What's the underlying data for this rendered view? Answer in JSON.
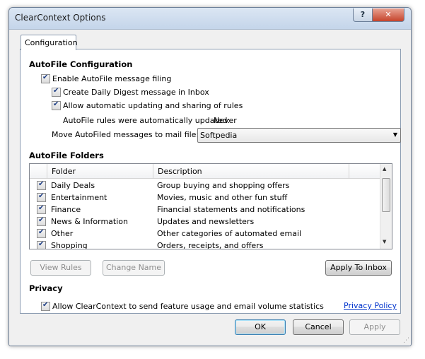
{
  "window": {
    "title": "ClearContext Options"
  },
  "titlebar": {
    "help": "?",
    "close": "✕"
  },
  "tab": {
    "label": "Configuration"
  },
  "autofile": {
    "heading": "AutoFile Configuration",
    "enable": "Enable AutoFile message filing",
    "digest": "Create Daily Digest message in Inbox",
    "auto_update": "Allow automatic updating and sharing of rules",
    "rules_status_label": "AutoFile rules were automatically updated:",
    "rules_status_value": "Never",
    "move_label": "Move AutoFiled messages to mail file:",
    "move_value": "Softpedia"
  },
  "folders": {
    "heading": "AutoFile Folders",
    "col_folder": "Folder",
    "col_description": "Description",
    "rows": [
      {
        "folder": "Daily Deals",
        "description": "Group buying and shopping offers"
      },
      {
        "folder": "Entertainment",
        "description": "Movies, music and other fun stuff"
      },
      {
        "folder": "Finance",
        "description": "Financial statements and notifications"
      },
      {
        "folder": "News & Information",
        "description": "Updates and newsletters"
      },
      {
        "folder": "Other",
        "description": "Other categories of automated email"
      },
      {
        "folder": "Shopping",
        "description": "Orders, receipts, and offers"
      }
    ],
    "view_rules": "View Rules",
    "change_name": "Change Name",
    "apply_inbox": "Apply To Inbox"
  },
  "privacy": {
    "heading": "Privacy",
    "allow_stats": "Allow ClearContext to send feature usage and email volume statistics",
    "policy_link": "Privacy Policy"
  },
  "footer": {
    "ok": "OK",
    "cancel": "Cancel",
    "apply": "Apply"
  }
}
